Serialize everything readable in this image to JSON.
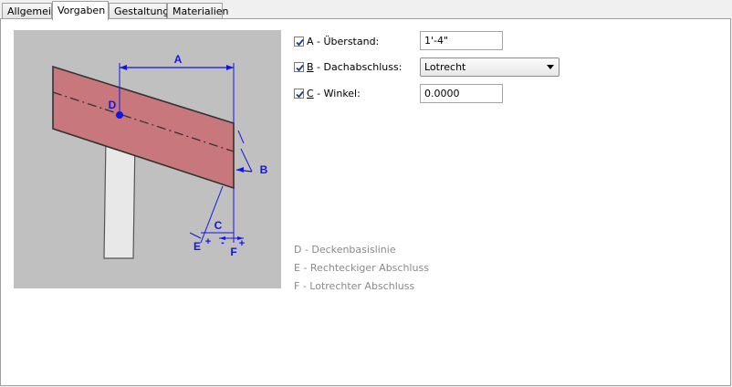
{
  "tabs": [
    {
      "label": "Allgemein",
      "active": false
    },
    {
      "label": "Vorgaben",
      "active": true
    },
    {
      "label": "Gestaltung",
      "active": false
    },
    {
      "label": "Materialien",
      "active": false
    }
  ],
  "diagram": {
    "labels": {
      "a": "A",
      "b": "B",
      "c": "C",
      "d": "D",
      "e": "E",
      "f": "F"
    },
    "signs": {
      "plus_left": "+",
      "minus": "-",
      "plus_right": "+"
    }
  },
  "options": [
    {
      "key_letter": "A",
      "label_rest": " - Überstand:",
      "checked": true,
      "value": "1'-4\"",
      "control": "text"
    },
    {
      "key_letter": "B",
      "label_rest": " - Dachabschluss:",
      "checked": true,
      "value": "Lotrecht",
      "control": "select"
    },
    {
      "key_letter": "C",
      "label_rest": " - Winkel:",
      "checked": true,
      "value": "0.0000",
      "control": "text"
    }
  ],
  "legend": [
    "D - Deckenbasislinie",
    "E - Rechteckiger Abschluss",
    "F - Lotrechter Abschluss"
  ],
  "colors": {
    "dimension_blue": "#1414e6",
    "roof_fill": "#c8787c",
    "legend_gray": "#8a8a8a"
  }
}
